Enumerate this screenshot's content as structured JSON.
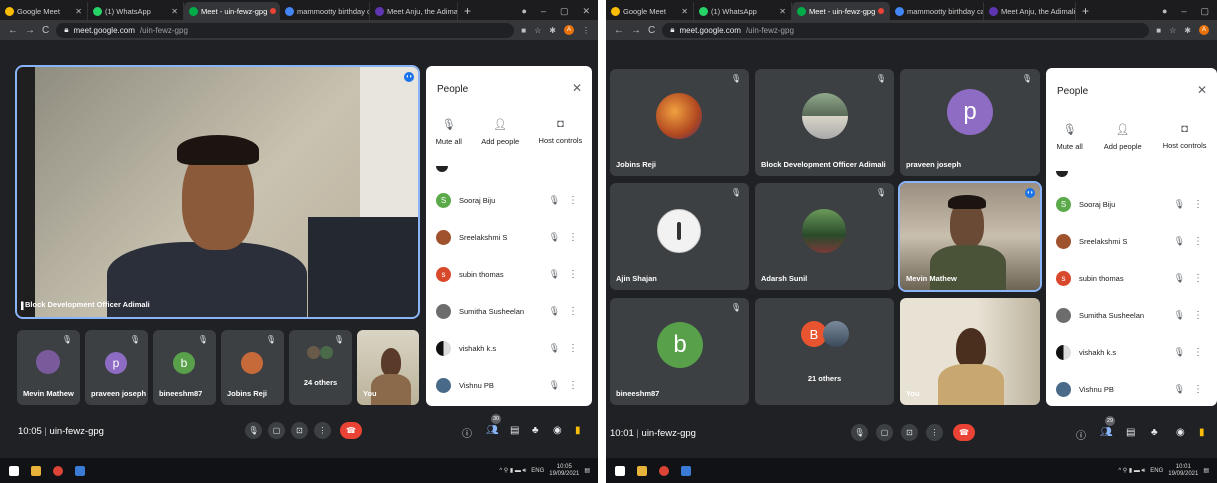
{
  "tabs": [
    {
      "label": "Google Meet",
      "color": "#fbbc04"
    },
    {
      "label": "(1) WhatsApp",
      "color": "#25d366"
    },
    {
      "label": "Meet - uin-fewz-gpg",
      "color": "#00ac47"
    },
    {
      "label": "mammootty birthday cak",
      "color": "#4285f4"
    },
    {
      "label": "Meet Anju, the Adimali-b",
      "color": "#5e35b1"
    }
  ],
  "url": {
    "host": "meet.google.com",
    "path": "/uin-fewz-gpg"
  },
  "people_panel": {
    "title": "People",
    "actions": {
      "mute_all": "Mute all",
      "add_people": "Add people",
      "host_controls": "Host controls"
    },
    "participants": [
      {
        "name": "Sooraj Biju",
        "initial": "S",
        "color": "#5aaa4a"
      },
      {
        "name": "Sreelakshmi S",
        "initial": "",
        "color": "#a0522d"
      },
      {
        "name": "subin thomas",
        "initial": "s",
        "color": "#d8482b"
      },
      {
        "name": "Sumitha Susheelan",
        "initial": "",
        "color": "#6d6d6d"
      },
      {
        "name": "vishakh k.s",
        "initial": "",
        "color": "#111111"
      },
      {
        "name": "Vishnu PB",
        "initial": "",
        "color": "#4a6a8a"
      }
    ]
  },
  "shot1": {
    "main_tile_name": "Block Development Officer Adimali",
    "strip": [
      {
        "name": "Mevin Mathew",
        "initial": "",
        "color": "#7a5a9a"
      },
      {
        "name": "praveen joseph",
        "initial": "p",
        "color": "#8e6cc4"
      },
      {
        "name": "bineeshm87",
        "initial": "b",
        "color": "#58a04a"
      },
      {
        "name": "Jobins Reji",
        "initial": "",
        "color": "#c66a3a"
      },
      {
        "name": "24 others",
        "initial": "",
        "color": "#4a6a4a"
      },
      {
        "name": "You",
        "initial": "",
        "color": ""
      }
    ],
    "meeting_time": "10:05",
    "meeting_code": "uin-fewz-gpg",
    "participant_count": "30",
    "clock_time": "10:05",
    "clock_date": "19/09/2021",
    "lang": "ENG"
  },
  "shot2": {
    "tiles": [
      {
        "name": "Jobins Reji",
        "initial": "",
        "color": "#c66a3a"
      },
      {
        "name": "Block Development Officer Adimali",
        "initial": "",
        "color": "#6a7a6a"
      },
      {
        "name": "praveen joseph",
        "initial": "p",
        "color": "#8e6cc4"
      },
      {
        "name": "Ajin Shajan",
        "initial": "",
        "color": "#eeeeee"
      },
      {
        "name": "Adarsh Sunil",
        "initial": "",
        "color": "#4a7a4a"
      },
      {
        "name": "Mevin Mathew",
        "initial": "",
        "color": ""
      },
      {
        "name": "bineeshm87",
        "initial": "b",
        "color": "#58a04a"
      },
      {
        "name": "21 others",
        "initial": "B",
        "color": "#e8542f"
      },
      {
        "name": "You",
        "initial": "",
        "color": ""
      }
    ],
    "meeting_time": "10:01",
    "meeting_code": "uin-fewz-gpg",
    "participant_count": "29",
    "clock_time": "10:01",
    "clock_date": "19/09/2021",
    "lang": "ENG"
  },
  "separator": "|"
}
